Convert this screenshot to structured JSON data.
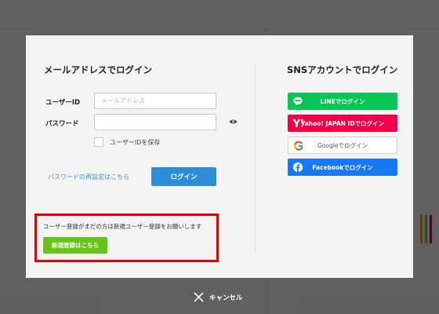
{
  "email_login": {
    "heading": "メールアドレスでログイン",
    "user_id_label": "ユーザーID",
    "user_id_placeholder": "メールアドレス",
    "password_label": "パスワード",
    "password_value": "",
    "save_id_label": "ユーザーIDを保存",
    "save_id_checked": false,
    "reset_password_link": "パスワードの再設定はこちら",
    "login_button": "ログイン"
  },
  "registration": {
    "prompt": "ユーザー登録がまだの方は新規ユーザー登録をお願いします",
    "button": "新規登録はこちら"
  },
  "sns_login": {
    "heading": "SNSアカウントでログイン",
    "buttons": [
      {
        "label": "LINEでログイン",
        "icon": "line-icon",
        "color": "#06c755"
      },
      {
        "label": "Yahoo! JAPAN IDでログイン",
        "icon": "yahoo-icon",
        "color": "#f0004a"
      },
      {
        "label": "Googleでログイン",
        "icon": "google-icon",
        "color": "#ffffff"
      },
      {
        "label": "Facebookでログイン",
        "icon": "facebook-icon",
        "color": "#1877f2"
      }
    ]
  },
  "cancel": {
    "label": "キャンセル",
    "icon": "close-icon"
  },
  "colors": {
    "login_button": "#2b8ed6",
    "register_button": "#67c219",
    "highlight_border": "#e60000",
    "link": "#3a8fcf"
  }
}
